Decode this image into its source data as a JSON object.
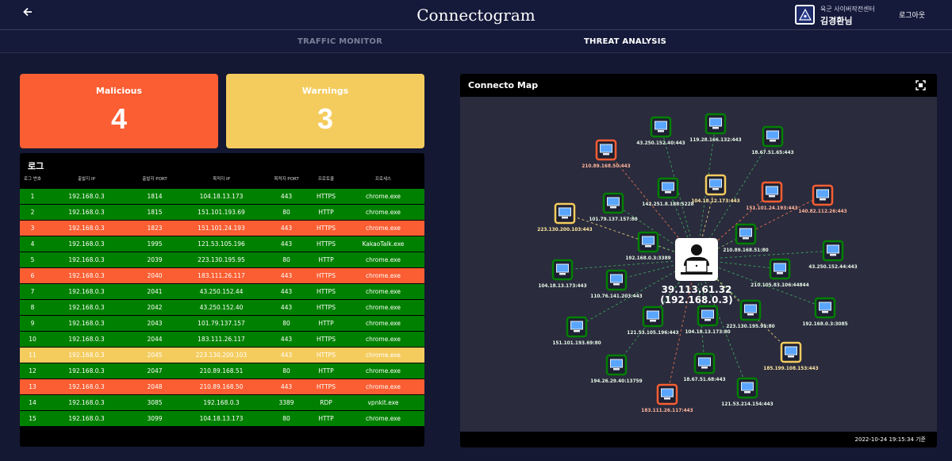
{
  "header": {
    "back_icon": "arrow-left-icon",
    "title": "Connectogram",
    "org_name": "육군 사이버작전센터",
    "user_name": "김경환님",
    "logout": "로그아웃"
  },
  "tabs": [
    {
      "label": "TRAFFIC MONITOR",
      "active": false
    },
    {
      "label": "THREAT ANALYSIS",
      "active": true
    }
  ],
  "summary": {
    "malicious_label": "Malicious",
    "malicious_count": "4",
    "warnings_label": "Warnings",
    "warnings_count": "3",
    "colors": {
      "malicious": "#fa5e32",
      "warning": "#f4cc5e",
      "normal": "#008000"
    }
  },
  "log": {
    "title": "로그",
    "columns": [
      "로그 번호",
      "출발지 IP",
      "출발지 PORT",
      "목적지 IP",
      "목적지 PORT",
      "프로토콜",
      "프로세스"
    ],
    "rows": [
      {
        "status": "normal",
        "cells": [
          "1",
          "192.168.0.3",
          "1814",
          "104.18.13.173",
          "443",
          "HTTPS",
          "chrome.exe"
        ]
      },
      {
        "status": "normal",
        "cells": [
          "2",
          "192.168.0.3",
          "1815",
          "151.101.193.69",
          "80",
          "HTTP",
          "chrome.exe"
        ]
      },
      {
        "status": "malicious",
        "cells": [
          "3",
          "192.168.0.3",
          "1823",
          "151.101.24.193",
          "443",
          "HTTPS",
          "chrome.exe"
        ]
      },
      {
        "status": "normal",
        "cells": [
          "4",
          "192.168.0.3",
          "1995",
          "121.53.105.196",
          "443",
          "HTTPS",
          "KakaoTalk.exe"
        ]
      },
      {
        "status": "normal",
        "cells": [
          "5",
          "192.168.0.3",
          "2039",
          "223.130.195.95",
          "80",
          "HTTP",
          "chrome.exe"
        ]
      },
      {
        "status": "malicious",
        "cells": [
          "6",
          "192.168.0.3",
          "2040",
          "183.111.26.117",
          "443",
          "HTTPS",
          "chrome.exe"
        ]
      },
      {
        "status": "normal",
        "cells": [
          "7",
          "192.168.0.3",
          "2041",
          "43.250.152.44",
          "443",
          "HTTPS",
          "chrome.exe"
        ]
      },
      {
        "status": "normal",
        "cells": [
          "8",
          "192.168.0.3",
          "2042",
          "43.250.152.40",
          "443",
          "HTTPS",
          "chrome.exe"
        ]
      },
      {
        "status": "normal",
        "cells": [
          "9",
          "192.168.0.3",
          "2043",
          "101.79.137.157",
          "80",
          "HTTP",
          "chrome.exe"
        ]
      },
      {
        "status": "normal",
        "cells": [
          "10",
          "192.168.0.3",
          "2044",
          "183.111.26.117",
          "443",
          "HTTPS",
          "chrome.exe"
        ]
      },
      {
        "status": "warning",
        "cells": [
          "11",
          "192.168.0.3",
          "2045",
          "223.130.200.103",
          "443",
          "HTTPS",
          "chrome.exe"
        ]
      },
      {
        "status": "normal",
        "cells": [
          "12",
          "192.168.0.3",
          "2047",
          "210.89.168.51",
          "80",
          "HTTP",
          "chrome.exe"
        ]
      },
      {
        "status": "malicious",
        "cells": [
          "13",
          "192.168.0.3",
          "2048",
          "210.89.168.50",
          "443",
          "HTTPS",
          "chrome.exe"
        ]
      },
      {
        "status": "normal",
        "cells": [
          "14",
          "192.168.0.3",
          "3085",
          "192.168.0.3",
          "3389",
          "RDP",
          "vpnkit.exe"
        ]
      },
      {
        "status": "normal",
        "cells": [
          "15",
          "192.168.0.3",
          "3099",
          "104.18.13.173",
          "80",
          "HTTP",
          "chrome.exe"
        ]
      }
    ]
  },
  "map": {
    "title": "Connecto Map",
    "expand_icon": "fullscreen-icon",
    "center_icon": "user-laptop-icon",
    "node_icon": "monitor-icon",
    "center": {
      "ip": "39.113.61.32",
      "local": "(192.168.0.3)"
    },
    "nodes": [
      {
        "label": "43.250.152.40:443",
        "status": "normal"
      },
      {
        "label": "119.28.166.132:443",
        "status": "normal"
      },
      {
        "label": "18.67.51.65:443",
        "status": "normal"
      },
      {
        "label": "210.89.168.50:443",
        "status": "malicious"
      },
      {
        "label": "142.251.8.188:5228",
        "status": "normal"
      },
      {
        "label": "104.18.12.173:443",
        "status": "warning"
      },
      {
        "label": "151.101.24.193:443",
        "status": "malicious"
      },
      {
        "label": "140.82.112.26:443",
        "status": "malicious"
      },
      {
        "label": "101.79.137.157:80",
        "status": "normal"
      },
      {
        "label": "223.130.200.103:443",
        "status": "warning"
      },
      {
        "label": "192.168.0.3:3389",
        "status": "normal"
      },
      {
        "label": "210.89.168.51:80",
        "status": "normal"
      },
      {
        "label": "43.250.152.44:443",
        "status": "normal"
      },
      {
        "label": "104.18.13.173:443",
        "status": "normal"
      },
      {
        "label": "110.76.141.203:443",
        "status": "normal"
      },
      {
        "label": "210.105.83.106:44844",
        "status": "normal"
      },
      {
        "label": "104.18.13.173:80",
        "status": "normal"
      },
      {
        "label": "121.53.105.196:443",
        "status": "normal"
      },
      {
        "label": "223.130.195.95:80",
        "status": "normal"
      },
      {
        "label": "192.168.0.3:3085",
        "status": "normal"
      },
      {
        "label": "151.101.193.69:80",
        "status": "normal"
      },
      {
        "label": "185.199.108.153:443",
        "status": "warning"
      },
      {
        "label": "18.67.51.68:443",
        "status": "normal"
      },
      {
        "label": "194.26.29.40:13759",
        "status": "normal"
      },
      {
        "label": "121.53.214.154:443",
        "status": "normal"
      },
      {
        "label": "183.111.26.117:443",
        "status": "malicious"
      }
    ],
    "timestamp": "2022-10-24 19:15:34 기준"
  }
}
